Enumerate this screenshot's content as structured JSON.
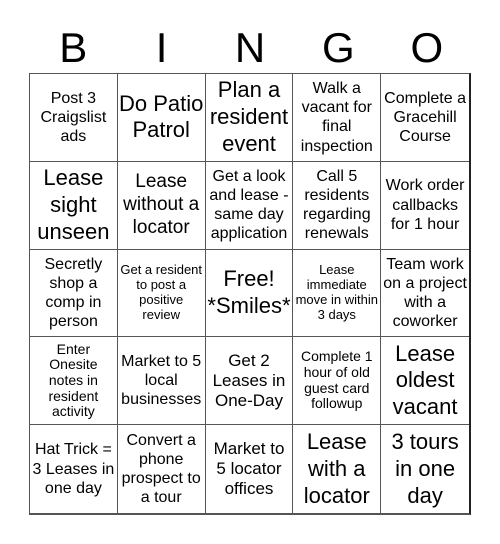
{
  "header": {
    "letters": [
      "B",
      "I",
      "N",
      "G",
      "O"
    ]
  },
  "cells": [
    {
      "text": "Post 3 Craigslist ads",
      "size": "s"
    },
    {
      "text": "Do Patio Patrol",
      "size": "xl"
    },
    {
      "text": "Plan a resident event",
      "size": "xl"
    },
    {
      "text": "Walk a vacant for final inspection",
      "size": "s"
    },
    {
      "text": "Complete a Gracehill Course",
      "size": "s"
    },
    {
      "text": "Lease sight unseen",
      "size": "xl"
    },
    {
      "text": "Lease without a locator",
      "size": "l"
    },
    {
      "text": "Get a look and lease - same day application",
      "size": "s"
    },
    {
      "text": "Call 5 residents regarding renewals",
      "size": "s"
    },
    {
      "text": "Work order callbacks for 1 hour",
      "size": "s"
    },
    {
      "text": "Secretly shop a comp in person",
      "size": "s"
    },
    {
      "text": "Get a resident to post a positive review",
      "size": "xxs"
    },
    {
      "text": "Free! *Smiles*",
      "size": "xl"
    },
    {
      "text": "Lease immediate move in within 3 days",
      "size": "xxs"
    },
    {
      "text": "Team work on a project with a coworker",
      "size": "s"
    },
    {
      "text": "Enter Onesite notes in resident activity",
      "size": "xs"
    },
    {
      "text": "Market to 5 local businesses",
      "size": "s"
    },
    {
      "text": "Get 2 Leases in One-Day",
      "size": "m"
    },
    {
      "text": "Complete 1 hour of old guest card followup",
      "size": "xs"
    },
    {
      "text": "Lease oldest vacant",
      "size": "xl"
    },
    {
      "text": "Hat Trick = 3 Leases in one day",
      "size": "s"
    },
    {
      "text": "Convert a phone prospect to a tour",
      "size": "s"
    },
    {
      "text": "Market to 5 locator offices",
      "size": "m"
    },
    {
      "text": "Lease with a locator",
      "size": "xl"
    },
    {
      "text": "3 tours in one day",
      "size": "xl"
    }
  ]
}
